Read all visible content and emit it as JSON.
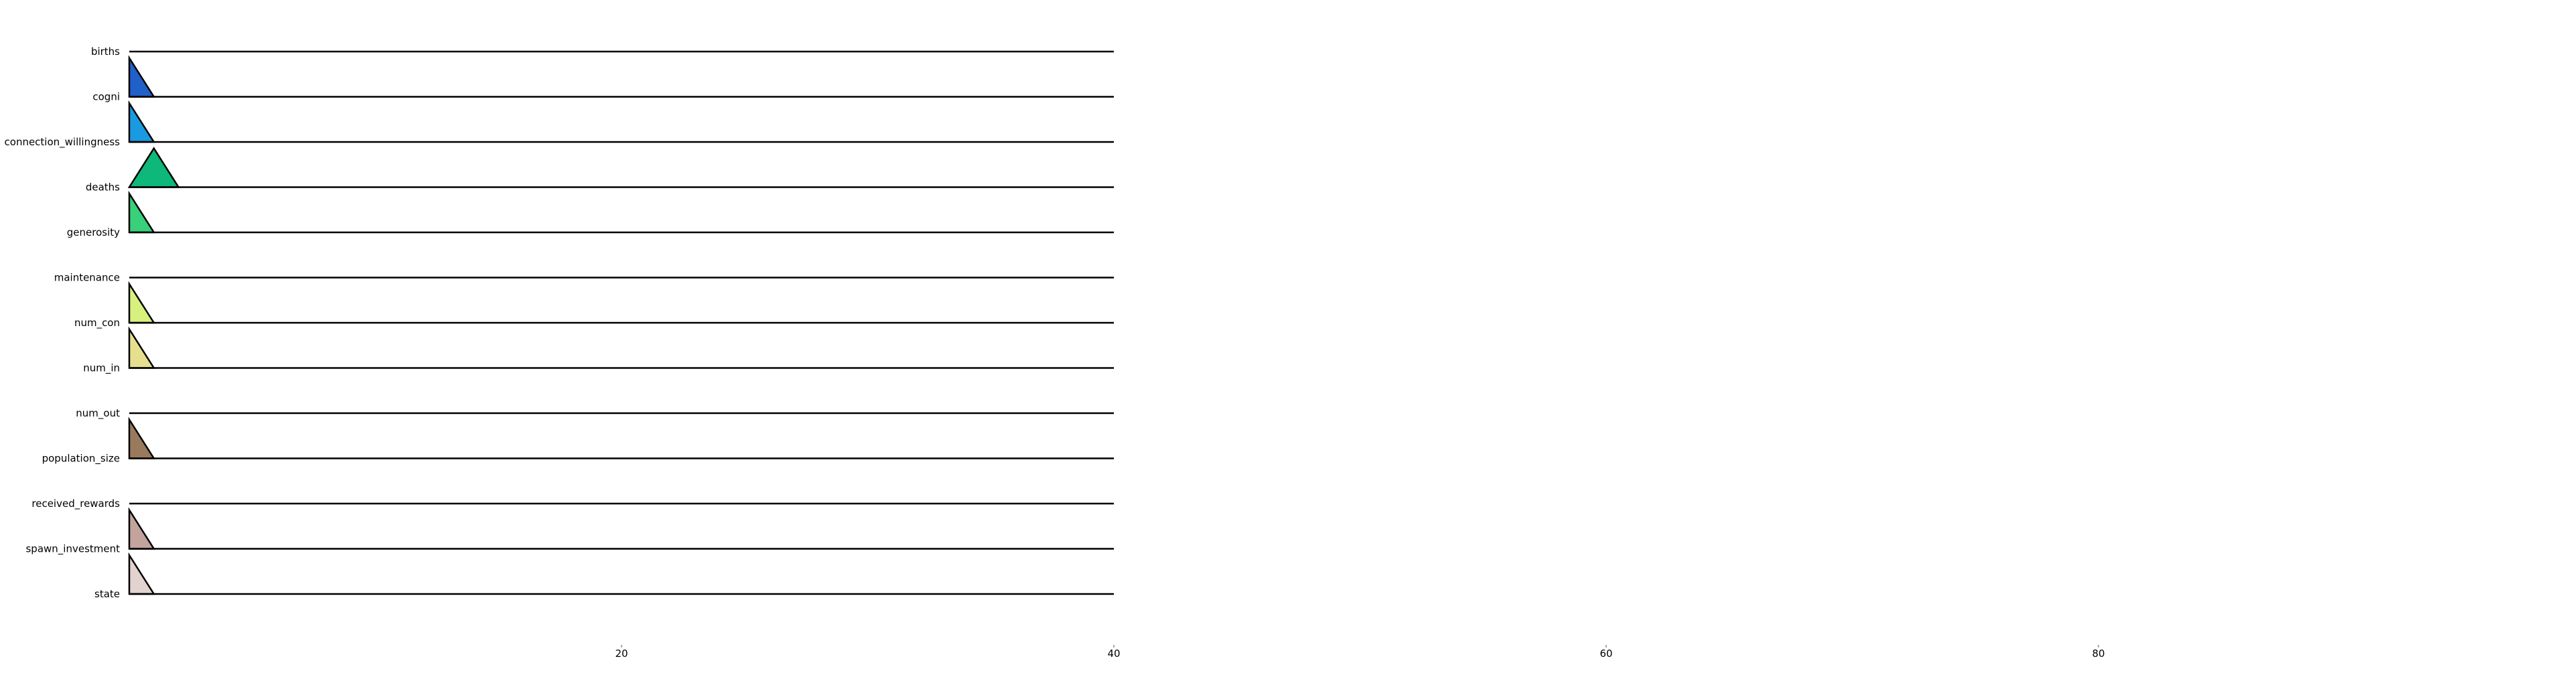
{
  "chart_data": {
    "type": "area",
    "title": "",
    "xlabel": "",
    "ylabel": "",
    "xlim": [
      0,
      40
    ],
    "x_ticks": [
      20,
      40,
      60,
      80
    ],
    "grid": false,
    "legend": "none",
    "series": [
      {
        "name": "births",
        "color": "#1f3a93",
        "peak_x": 0,
        "support_end": 0
      },
      {
        "name": "cogni",
        "color": "#2060c8",
        "peak_x": 0,
        "support_end": 1
      },
      {
        "name": "connection_willingness",
        "color": "#1a9ae0",
        "peak_x": 0,
        "support_end": 1
      },
      {
        "name": "deaths",
        "color": "#0db87a",
        "peak_x": 1,
        "support_end": 2
      },
      {
        "name": "generosity",
        "color": "#38d07a",
        "peak_x": 0,
        "support_end": 1
      },
      {
        "name": "maintenance",
        "color": "#8fe07a",
        "peak_x": 0,
        "support_end": 0
      },
      {
        "name": "num_con",
        "color": "#d8f07e",
        "peak_x": 0,
        "support_end": 1
      },
      {
        "name": "num_in",
        "color": "#e6e08e",
        "peak_x": 0,
        "support_end": 1
      },
      {
        "name": "num_out",
        "color": "#c8b890",
        "peak_x": 0,
        "support_end": 0
      },
      {
        "name": "population_size",
        "color": "#9a7a5c",
        "peak_x": 0,
        "support_end": 1
      },
      {
        "name": "received_rewards",
        "color": "#b89a8a",
        "peak_x": 0,
        "support_end": 0
      },
      {
        "name": "spawn_investment",
        "color": "#c2a49c",
        "peak_x": 0,
        "support_end": 1
      },
      {
        "name": "state",
        "color": "#e2d2d0",
        "peak_x": 0,
        "support_end": 1
      }
    ]
  }
}
